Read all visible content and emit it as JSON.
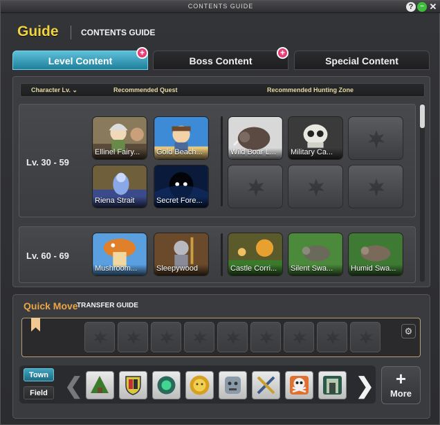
{
  "window": {
    "title": "CONTENTS GUIDE",
    "help_glyph": "?",
    "minimize_glyph": "−",
    "close_glyph": "✕"
  },
  "header": {
    "title": "Guide",
    "subtitle": "CONTENTS GUIDE"
  },
  "tabs": [
    {
      "label": "Level Content",
      "active": true,
      "badge": "+"
    },
    {
      "label": "Boss Content",
      "active": false,
      "badge": "+"
    },
    {
      "label": "Special Content",
      "active": false
    }
  ],
  "columns": {
    "level": "Character Lv.",
    "level_caret": "⌄",
    "quest": "Recommended Quest",
    "hunting": "Recommended Hunting Zone"
  },
  "level_rows": [
    {
      "level": "Lv.  30 - 59",
      "quests": [
        "Ellinel Fairy...",
        "Gold Beach...",
        "Riena Strait",
        "Secret Fore..."
      ],
      "zones": [
        "Wild Boar L...",
        "Military Ca..."
      ]
    },
    {
      "level": "Lv.  60 - 69",
      "quests": [
        "Mushroom...",
        "Sleepywood"
      ],
      "zones": [
        "Castle Corri...",
        "Silent Swa...",
        "Humid Swa..."
      ]
    }
  ],
  "quick_move": {
    "title": "Quick Move",
    "subtitle": "TRANSFER GUIDE",
    "settings_glyph": "⚙",
    "modes": [
      "Town",
      "Field"
    ],
    "active_mode": "Town",
    "prev_glyph": "❮",
    "next_glyph": "❯",
    "icons": [
      "tree-house-icon",
      "shield-crest-icon",
      "green-orb-icon",
      "sun-face-icon",
      "stone-face-icon",
      "crossed-tools-icon",
      "skull-crossbones-icon",
      "stone-gate-icon"
    ],
    "more_glyph": "+",
    "more_label": "More"
  },
  "colors": {
    "accent": "#2a93b0",
    "guide_title": "#f0d23c",
    "quick_move_title": "#e9a646",
    "badge": "#e0306a"
  }
}
